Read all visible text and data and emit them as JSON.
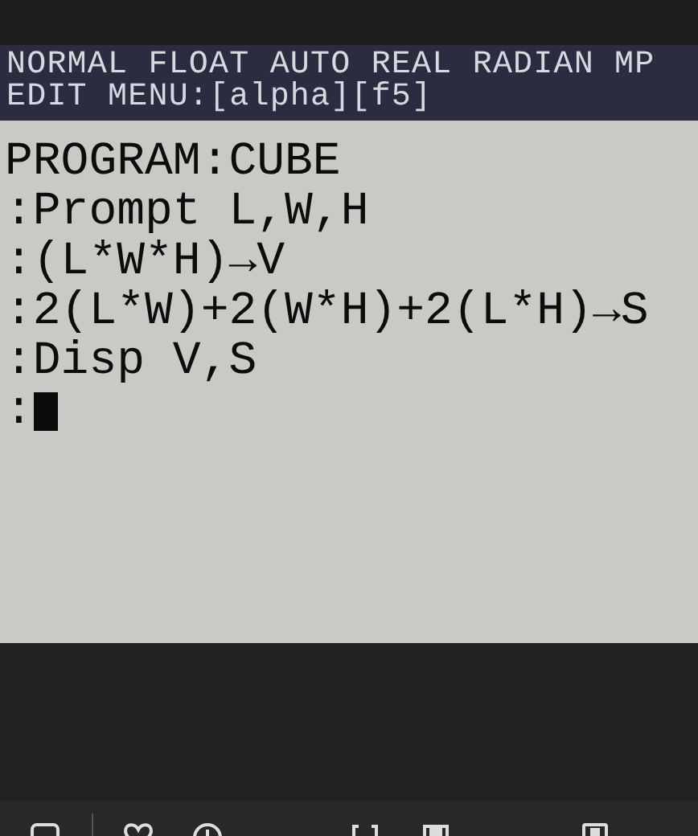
{
  "status_bar": {
    "mode_line": "NORMAL FLOAT AUTO REAL RADIAN MP",
    "hint_line": "EDIT MENU:[alpha][f5]"
  },
  "editor": {
    "title": "PROGRAM:CUBE",
    "lines": [
      ":Prompt L,W,H",
      ":(L*W*H)→V",
      ":2(L*W)+2(W*H)+2(L*H)→S",
      ":Disp V,S",
      ":"
    ]
  }
}
